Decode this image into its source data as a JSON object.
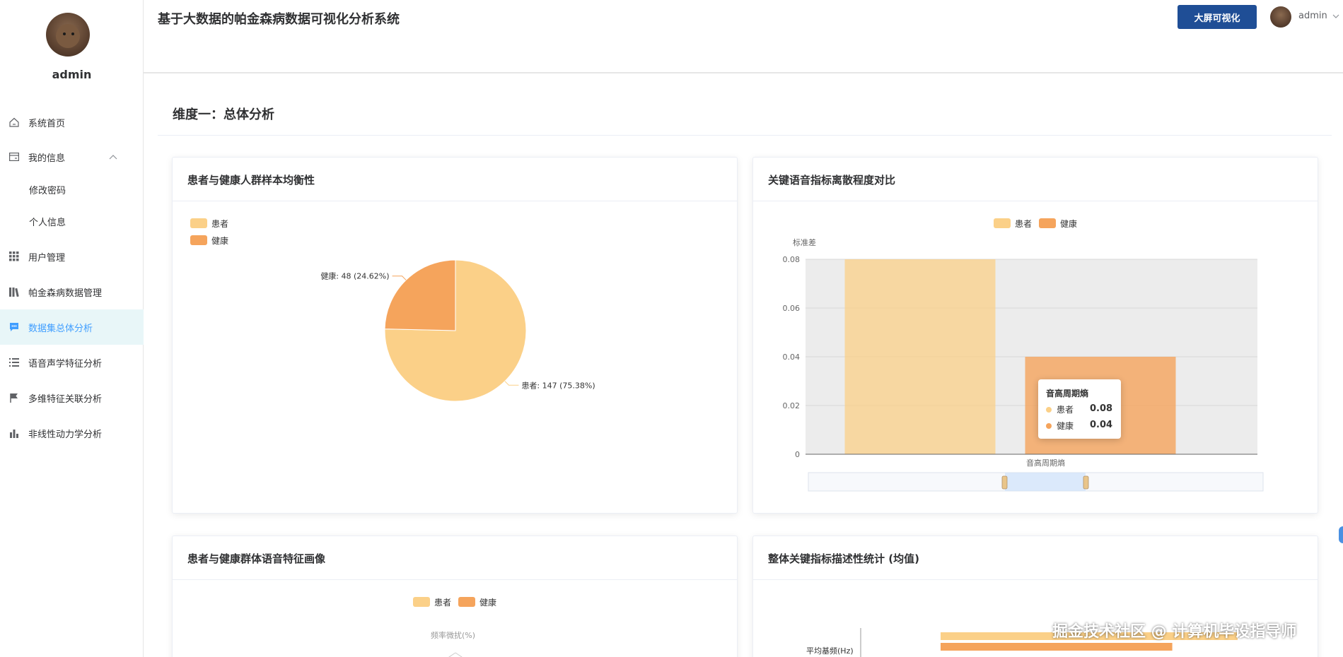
{
  "sidebar": {
    "username": "admin",
    "items": [
      {
        "label": "系统首页",
        "icon": "home-icon"
      },
      {
        "label": "我的信息",
        "icon": "id-card-icon"
      },
      {
        "label": "修改密码"
      },
      {
        "label": "个人信息"
      },
      {
        "label": "用户管理",
        "icon": "grid-icon"
      },
      {
        "label": "帕金森病数据管理",
        "icon": "books-icon"
      },
      {
        "label": "数据集总体分析",
        "icon": "chat-icon",
        "active": true
      },
      {
        "label": "语音声学特征分析",
        "icon": "list-icon"
      },
      {
        "label": "多维特征关联分析",
        "icon": "flag-icon"
      },
      {
        "label": "非线性动力学分析",
        "icon": "bar-chart-icon"
      }
    ]
  },
  "header": {
    "title": "基于大数据的帕金森病数据可视化分析系统",
    "screen_button": "大屏可视化",
    "username": "admin"
  },
  "section": {
    "title": "维度一：总体分析"
  },
  "colors": {
    "patient": "#fbd088",
    "healthy": "#f5a45c",
    "accent": "#409eff",
    "active_bg": "#e8f6f8"
  },
  "cards": {
    "pie": {
      "title": "患者与健康人群样本均衡性"
    },
    "bar": {
      "title": "关键语音指标离散程度对比"
    },
    "radar": {
      "title": "患者与健康群体语音特征画像"
    },
    "stats": {
      "title": "整体关键指标描述性统计 (均值)"
    }
  },
  "chart_data": [
    {
      "type": "pie",
      "title": "患者与健康人群样本均衡性",
      "legend": [
        "患者",
        "健康"
      ],
      "slices": [
        {
          "name": "患者",
          "value": 147,
          "percent": "75.38%",
          "label": "患者: 147 (75.38%)"
        },
        {
          "name": "健康",
          "value": 48,
          "percent": "24.62%",
          "label": "健康: 48 (24.62%)"
        }
      ]
    },
    {
      "type": "bar",
      "title": "关键语音指标离散程度对比",
      "ylabel": "标准差",
      "categories": [
        "音高周期熵"
      ],
      "series": [
        {
          "name": "患者",
          "values": [
            0.08
          ]
        },
        {
          "name": "健康",
          "values": [
            0.04
          ]
        }
      ],
      "yticks": [
        "0",
        "0.02",
        "0.04",
        "0.06",
        "0.08"
      ],
      "ylim": [
        0,
        0.08
      ],
      "tooltip": {
        "title": "音高周期熵",
        "rows": [
          {
            "name": "患者",
            "value": "0.08"
          },
          {
            "name": "健康",
            "value": "0.04"
          }
        ]
      }
    },
    {
      "type": "radar",
      "title": "患者与健康群体语音特征画像",
      "legend": [
        "患者",
        "健康"
      ],
      "indicators": [
        "频率微扰(%)"
      ]
    },
    {
      "type": "bar",
      "title": "整体关键指标描述性统计 (均值)",
      "categories": [
        "平均基频(Hz)"
      ],
      "series": [
        {
          "name": "患者",
          "values": [
            1
          ]
        },
        {
          "name": "健康",
          "values": [
            0.78
          ]
        }
      ]
    }
  ],
  "watermark": "掘金技术社区 @ 计算机毕设指导师"
}
